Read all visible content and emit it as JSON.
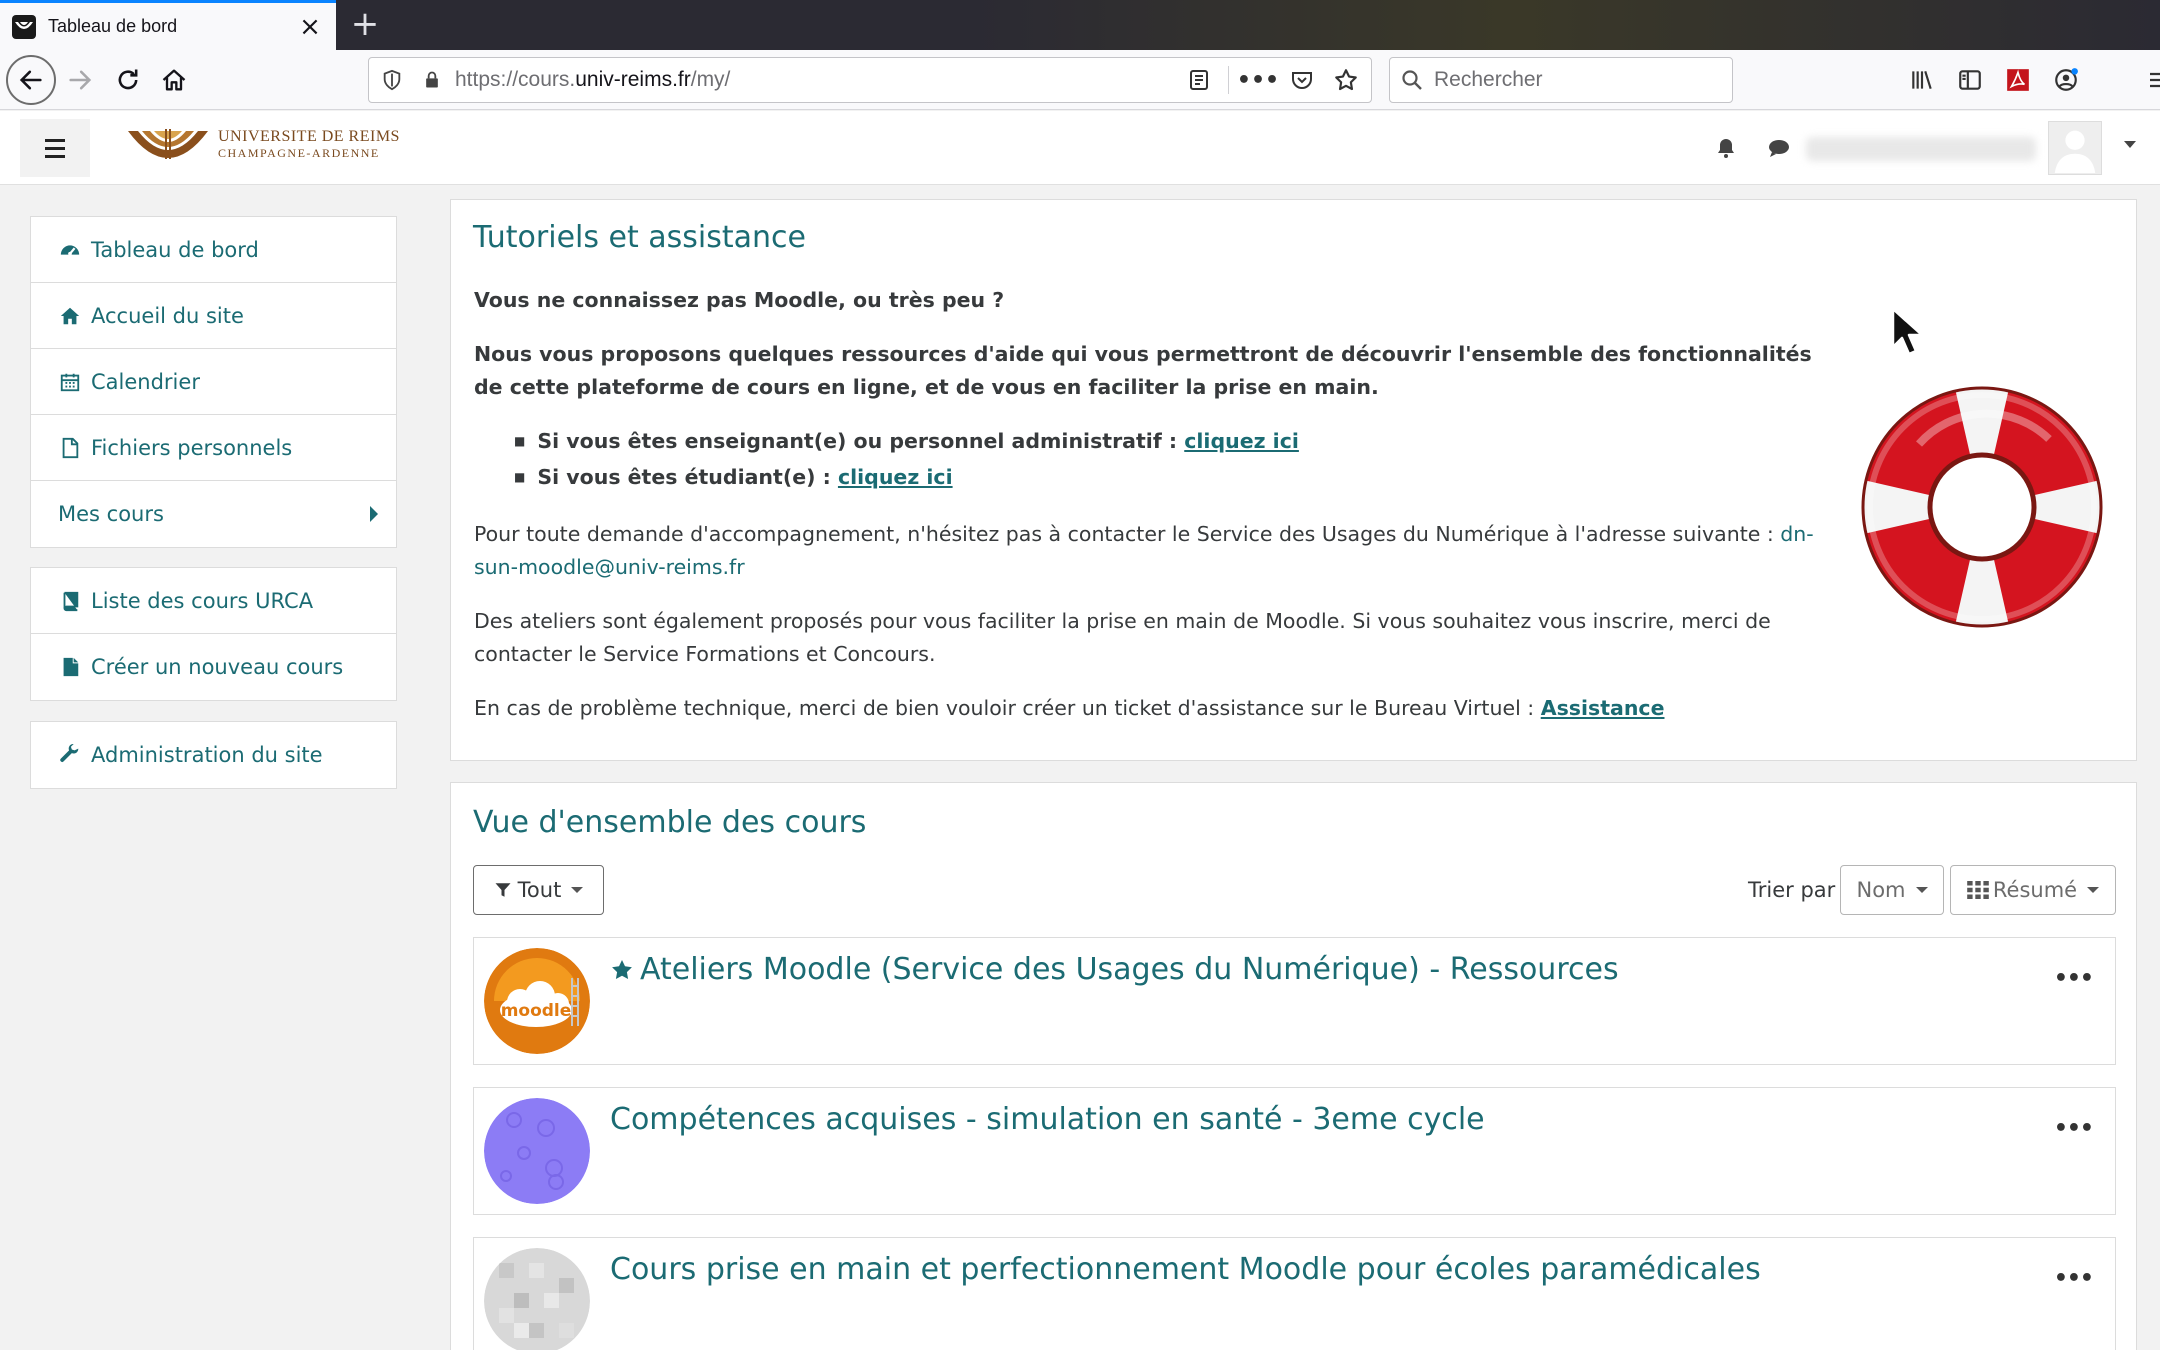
{
  "browser": {
    "tab_title": "Tableau de bord",
    "url_prefix": "https://cours.",
    "url_domain": "univ-reims.fr",
    "url_path": "/my/",
    "search_placeholder": "Rechercher"
  },
  "header": {
    "logo_line1": "UNIVERSITE DE REIMS",
    "logo_line2": "CHAMPAGNE-ARDENNE"
  },
  "sidebar": {
    "group1": [
      {
        "label": "Tableau de bord",
        "icon": "dashboard-icon"
      },
      {
        "label": "Accueil du site",
        "icon": "home-icon"
      },
      {
        "label": "Calendrier",
        "icon": "calendar-icon"
      },
      {
        "label": "Fichiers personnels",
        "icon": "file-icon"
      },
      {
        "label": "Mes cours",
        "icon": "caret-right-icon"
      }
    ],
    "group2": [
      {
        "label": "Liste des cours URCA",
        "icon": "book-icon"
      },
      {
        "label": "Créer un nouveau cours",
        "icon": "file-filled-icon"
      }
    ],
    "group3": [
      {
        "label": "Administration du site",
        "icon": "wrench-icon"
      }
    ]
  },
  "tutorials": {
    "title": "Tutoriels et assistance",
    "intro": "Vous ne connaissez pas Moodle, ou très peu ?",
    "lead": "Nous vous proposons quelques ressources d'aide qui vous permettront de découvrir l'ensemble des fonctionnalités de cette plateforme de cours en ligne, et de vous en faciliter la prise en main.",
    "bullet1_text": "Si vous êtes enseignant(e) ou personnel administratif : ",
    "bullet1_link": "cliquez ici",
    "bullet2_text": "Si vous êtes étudiant(e) : ",
    "bullet2_link": "cliquez ici",
    "contact_text": "Pour toute demande d'accompagnement, n'hésitez pas à contacter le Service des Usages du Numérique à l'adresse suivante : ",
    "contact_email": "dn-sun-moodle@univ-reims.fr",
    "workshops": "Des ateliers sont également proposés pour vous faciliter la prise en main de Moodle. Si vous souhaitez vous inscrire, merci de contacter le Service Formations et Concours.",
    "support_text": "En cas de problème technique, merci de bien vouloir créer un ticket d'assistance sur le Bureau Virtuel : ",
    "support_link": "Assistance"
  },
  "overview": {
    "title": "Vue d'ensemble des cours",
    "filter_label": "Tout",
    "sort_by_label": "Trier par",
    "sort_value": "Nom",
    "view_value": "Résumé",
    "courses": [
      {
        "name": "Ateliers Moodle (Service des Usages du Numérique) - Ressources",
        "starred": true
      },
      {
        "name": "Compétences acquises - simulation en santé - 3eme cycle",
        "starred": false
      },
      {
        "name": "Cours prise en main et perfectionnement Moodle pour écoles paramédicales",
        "starred": false
      }
    ],
    "course_menu_label": "•••"
  },
  "colors": {
    "accent": "#1b6b73",
    "tab_indicator": "#0a84ff",
    "lifebuoy_red": "#d4141f"
  }
}
